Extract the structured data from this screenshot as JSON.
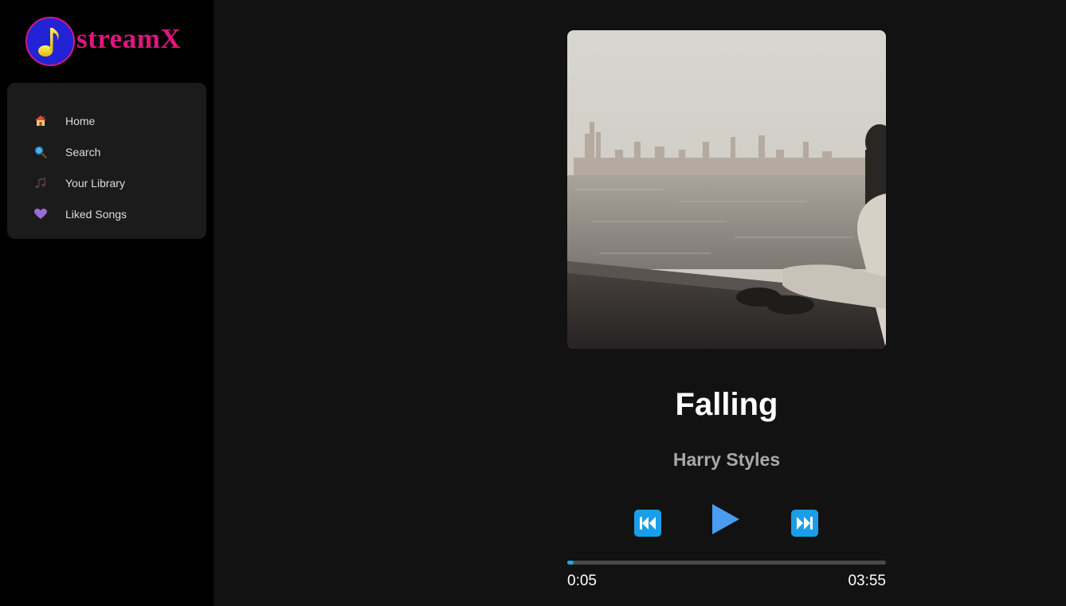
{
  "app": {
    "name": "streamX",
    "logo_icon": "music-note-icon"
  },
  "sidebar": {
    "items": [
      {
        "label": "Home",
        "icon": "home-icon"
      },
      {
        "label": "Search",
        "icon": "magnifier-icon"
      },
      {
        "label": "Your Library",
        "icon": "music-notes-icon"
      },
      {
        "label": "Liked Songs",
        "icon": "purple-heart-icon"
      }
    ]
  },
  "player": {
    "title": "Falling",
    "artist": "Harry Styles",
    "current_time": "0:05",
    "duration": "03:55",
    "progress": 0.02,
    "controls": {
      "previous": "previous-track-icon",
      "play": "play-icon",
      "next": "next-track-icon"
    }
  },
  "colors": {
    "accent": "#1ea6e8",
    "play": "#4a9cf0",
    "brand": "#e0167e",
    "brand_badge": "#2323d6"
  }
}
